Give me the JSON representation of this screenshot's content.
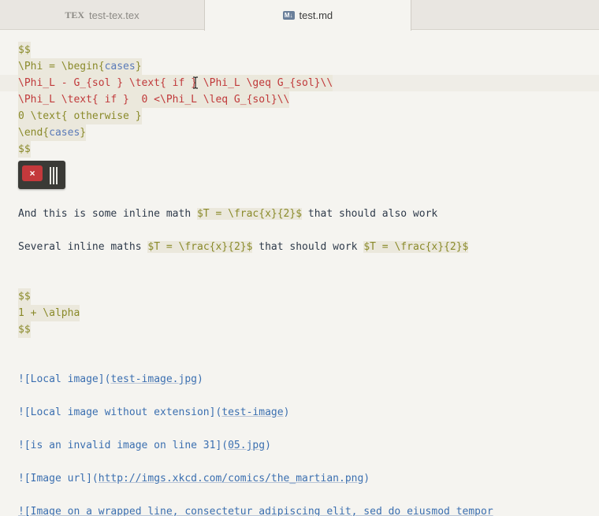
{
  "tabs": [
    {
      "icon": "TEX",
      "label": "test-tex.tex",
      "active": false
    },
    {
      "icon": "M↓",
      "label": "test.md",
      "active": true
    }
  ],
  "editor": {
    "lines": {
      "l1": "$$",
      "l2a": "\\Phi = \\begin{",
      "l2b": "cases",
      "l2c": "}",
      "l3a": "\\Phi_L - G_{sol } \\text{ if } \\Phi_L \\geq G_{sol}\\\\",
      "l4a": "\\Phi_L \\text{ if }  0 <\\Phi_L \\leq G_{sol}\\\\",
      "l5": "0 \\text{ otherwise }",
      "l6a": "\\end{",
      "l6b": "cases",
      "l6c": "}",
      "l7": "$$",
      "l8a": "And this is some inline math ",
      "l8b": "$T = \\frac{x}{2}$",
      "l8c": " that should also work",
      "l9a": "Several inline maths ",
      "l9b": "$T = \\frac{x}{2}$",
      "l9c": " that should work ",
      "l9d": "$T = \\frac{x}{2}$",
      "l10": "$$",
      "l11": "1 + \\alpha",
      "l12": "$$",
      "l13a": "![Local image](",
      "l13b": "test-image.jpg",
      "l13c": ")",
      "l14a": "![Local image without extension](",
      "l14b": "test-image",
      "l14c": ")",
      "l15a": "![is an invalid image on line 31](",
      "l15b": "05.jpg",
      "l15c": ")",
      "l16a": "![Image url](",
      "l16b": "http://imgs.xkcd.com/comics/the_martian.png",
      "l16c": ")",
      "l17": "![Image on a wrapped line, consectetur adipiscing elit, sed do eiusmod tempor"
    }
  },
  "widget": {
    "close_label": "×"
  },
  "colors": {
    "math": "#8a8a2a",
    "math_red": "#c0393a",
    "link": "#3b6fb0",
    "keyword": "#5a7ab8"
  }
}
